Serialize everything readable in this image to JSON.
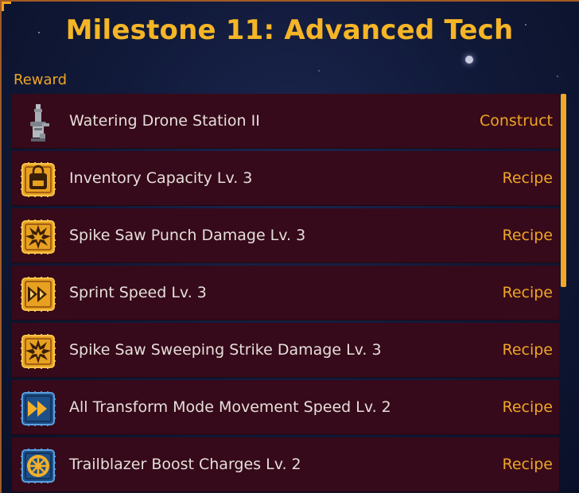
{
  "title": "Milestone 11: Advanced Tech",
  "section_label": "Reward",
  "colors": {
    "accent": "#f5b526",
    "row_background": "#360a1a",
    "orange_icon": "#e8a020",
    "blue_icon": "#1d4f88"
  },
  "rewards": [
    {
      "name": "Watering Drone Station II",
      "type": "Construct",
      "icon": "watering-drone-station-icon"
    },
    {
      "name": "Inventory Capacity Lv. 3",
      "type": "Recipe",
      "icon": "backpack-icon"
    },
    {
      "name": "Spike Saw Punch Damage Lv. 3",
      "type": "Recipe",
      "icon": "explosion-icon"
    },
    {
      "name": "Sprint Speed Lv. 3",
      "type": "Recipe",
      "icon": "fast-forward-icon"
    },
    {
      "name": "Spike Saw Sweeping Strike Damage Lv. 3",
      "type": "Recipe",
      "icon": "explosion-icon"
    },
    {
      "name": "All Transform Mode Movement Speed Lv. 2",
      "type": "Recipe",
      "icon": "fast-forward-icon"
    },
    {
      "name": "Trailblazer Boost Charges Lv. 2",
      "type": "Recipe",
      "icon": "wheel-icon"
    }
  ]
}
